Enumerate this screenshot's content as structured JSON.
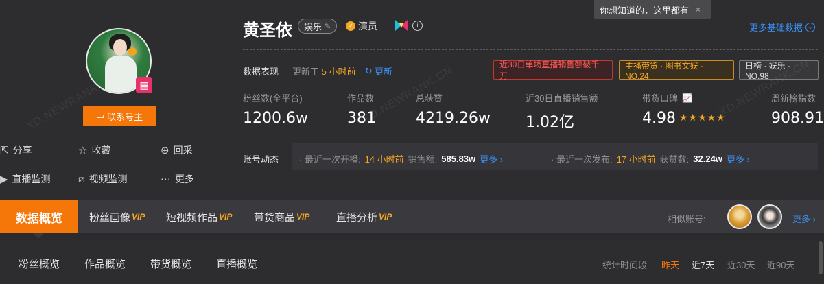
{
  "tooltip": {
    "text": "你想知道的，这里都有",
    "close": "×"
  },
  "profile": {
    "name": "黄圣依",
    "category_tag": "娱乐",
    "verified_label": "演员",
    "contact_button": "联系号主",
    "more_basic_data": "更多基础数据"
  },
  "actions": [
    {
      "label": "分享"
    },
    {
      "label": "收藏"
    },
    {
      "label": "回采"
    },
    {
      "label": "直播监测"
    },
    {
      "label": "视频监测"
    },
    {
      "label": "更多"
    }
  ],
  "watermark": "XD.NEWRANK.CN",
  "data_performance": {
    "label": "数据表现",
    "updated_prefix": "更新于",
    "updated_value": "5 小时前",
    "refresh_label": "更新",
    "badges": [
      {
        "text": "近30日单场直播销售额破千万"
      },
      {
        "text": "主播带货 · 图书文娱 · NO.24"
      },
      {
        "text": "日榜 · 娱乐 · NO.98"
      }
    ]
  },
  "stats": [
    {
      "label": "粉丝数(全平台)",
      "value": "1200.6w"
    },
    {
      "label": "作品数",
      "value": "381"
    },
    {
      "label": "总获赞",
      "value": "4219.26w"
    },
    {
      "label": "近30日直播销售额",
      "value": "1.02亿"
    },
    {
      "label": "带货口碑",
      "value": "4.98",
      "stars": 5
    },
    {
      "label": "周新榜指数",
      "value": "908.91"
    }
  ],
  "account_activity": {
    "label": "账号动态",
    "live": {
      "prefix": "· 最近一次开播:",
      "time": "14 小时前",
      "sales_label": "销售额:",
      "sales_value": "585.83w",
      "more": "更多 ›"
    },
    "post": {
      "prefix": "· 最近一次发布:",
      "time": "17 小时前",
      "likes_label": "获赞数:",
      "likes_value": "32.24w",
      "more": "更多 ›"
    }
  },
  "tabs": [
    {
      "label": "数据概览",
      "vip": ""
    },
    {
      "label": "粉丝画像",
      "vip": "VIP"
    },
    {
      "label": "短视频作品",
      "vip": "VIP"
    },
    {
      "label": "带货商品",
      "vip": "VIP"
    },
    {
      "label": "直播分析",
      "vip": "VIP"
    }
  ],
  "similar": {
    "label": "相似账号:",
    "more": "更多 ›"
  },
  "subtabs": [
    {
      "label": "粉丝概览"
    },
    {
      "label": "作品概览"
    },
    {
      "label": "带货概览"
    },
    {
      "label": "直播概览"
    }
  ],
  "period": {
    "label": "统计时间段",
    "options": [
      "昨天",
      "近7天",
      "近30天",
      "近90天"
    ]
  },
  "colors": {
    "accent": "#f5770a",
    "link": "#3a8ff0",
    "highlight": "#f5a623"
  }
}
